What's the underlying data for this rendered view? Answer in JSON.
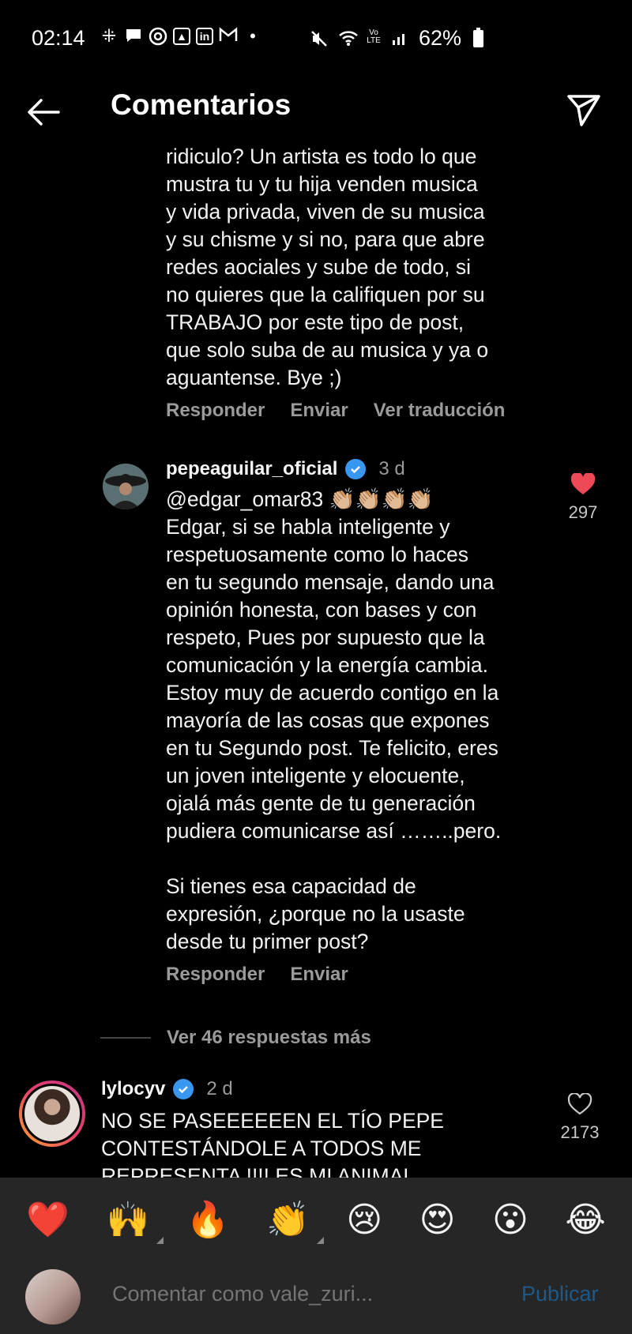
{
  "status_bar": {
    "time": "02:14",
    "battery": "62%",
    "icons": [
      "slack-icon",
      "chat-icon",
      "threads-icon",
      "image-icon",
      "linkedin-icon",
      "gmail-icon",
      "dot-icon",
      "mute-icon",
      "wifi-icon",
      "volte-icon",
      "signal-icon",
      "battery-icon"
    ],
    "volte": "Vo LTE"
  },
  "header": {
    "title": "Comentarios"
  },
  "comment_partial": {
    "text": "ridiculo? Un artista es todo lo que\nmustra tu y tu hija venden musica\ny vida privada, viven de su musica\ny su chisme y si no, para que abre\nredes aociales y sube de todo, si\nno quieres que la califiquen por su\nTRABAJO por este tipo de post,\nque solo suba de au musica y ya o\naguantense. Bye ;)",
    "actions": [
      "Responder",
      "Enviar",
      "Ver traducción"
    ]
  },
  "reply": {
    "username": "pepeaguilar_oficial",
    "time": "3 d",
    "mention": "@edgar_omar83 👏🏼👏🏼👏🏼👏🏼",
    "text": "Edgar, si se habla inteligente y\nrespetuosamente como lo haces\nen tu segundo mensaje, dando una\nopinión honesta, con bases y con\nrespeto, Pues por supuesto que la\ncomunicación y la energía cambia.\nEstoy muy de acuerdo contigo en la\nmayoría de las cosas que expones\nen tu Segundo post. Te felicito, eres\nun joven inteligente y elocuente,\nojalá más gente de tu generación\npudiera comunicarse así ……..pero.\n\nSi tienes esa capacidad de\nexpresión, ¿porque no la usaste\ndesde tu primer post?",
    "likes": "297",
    "liked": true,
    "actions": [
      "Responder",
      "Enviar"
    ]
  },
  "more_replies": "Ver 46 respuestas más",
  "comment_next": {
    "username": "lylocyv",
    "time": "2 d",
    "text": "NO SE PASEEEEEEN EL TÍO PEPE\nCONTESTÁNDOLE A TODOS ME\nREPRESENTA !!!! ES MI ANIMAL",
    "likes": "2173",
    "liked": false
  },
  "emoji_bar": [
    "❤️",
    "🙌",
    "🔥",
    "👏",
    "😢",
    "😍",
    "😮",
    "😂"
  ],
  "composer": {
    "placeholder": "Comentar como vale_zuri...",
    "publish_label": "Publicar"
  },
  "colors": {
    "background": "#000000",
    "panel": "#262626",
    "secondary_text": "#9a9a9a",
    "verified": "#3897f0",
    "like_red": "#ed4956",
    "publish_disabled": "#1d5a8a"
  }
}
